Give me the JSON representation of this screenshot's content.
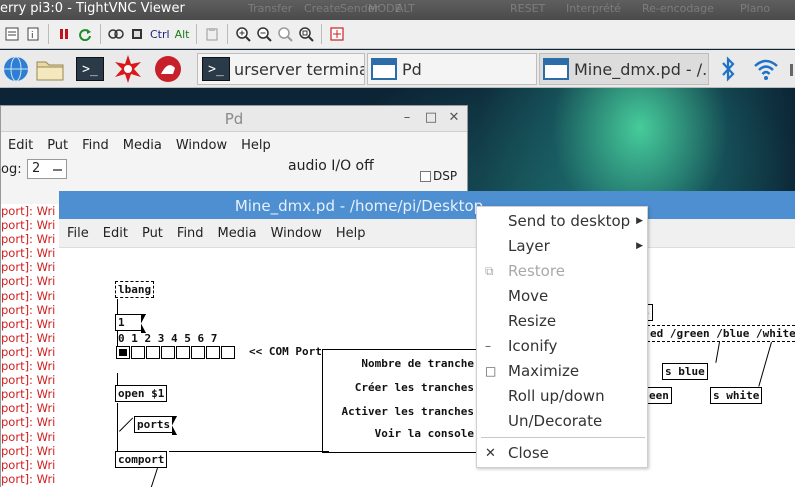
{
  "vnc": {
    "title": "erry pi3:0 - TightVNC Viewer",
    "ghost_labels": [
      "Transfer",
      "Create",
      "Sender",
      "MODE",
      "ALT",
      "RESET",
      "Interprété",
      "Re-encodage",
      "Plano"
    ],
    "toolbar": {
      "ctrl_label": "Ctrl",
      "alt_label": "Alt",
      "icons": [
        "options-icon",
        "info-icon",
        "pause-icon",
        "refresh-icon",
        "keyboard-icon",
        "ctrl-alt-del-icon",
        "clipboard-icon",
        "zoom-in-icon",
        "zoom-out-icon",
        "zoom-100-icon",
        "zoom-fit-icon",
        "fullscreen-icon"
      ]
    }
  },
  "taskbar": {
    "launchers": [
      "globe-icon",
      "folder-icon",
      "terminal-icon",
      "wolfram-icon",
      "mathematica-icon"
    ],
    "tasks": [
      {
        "label": "urserver terminal",
        "icon": "terminal-icon",
        "active": false
      },
      {
        "label": "Pd",
        "icon": "window-icon",
        "active": false
      },
      {
        "label": "Mine_dmx.pd  - /...",
        "icon": "window-icon",
        "active": true
      }
    ],
    "tray": [
      "bluetooth-icon",
      "wifi-icon"
    ]
  },
  "pd_window": {
    "title": "Pd",
    "menu": [
      "Edit",
      "Put",
      "Find",
      "Media",
      "Window",
      "Help"
    ],
    "log_label": "og:",
    "log_value": "2",
    "audio_status": "audio I/O off",
    "dsp_label": "DSP",
    "log_lines": [
      "port]: Wri",
      "port]: Wri",
      "port]: Wri",
      "port]: Wri",
      "port]: Wri",
      "port]: Wri",
      "port]: Wri",
      "port]: Wri",
      "port]: Wri",
      "port]: Wri",
      "port]: Wri",
      "port]: Wri",
      "port]: Wri",
      "port]: Wri",
      "port]: Wri",
      "port]: Wri",
      "port]: Wri",
      "port]: Wri",
      "port]: Wri",
      "port]: Wri"
    ]
  },
  "mine_window": {
    "title": "Mine_dmx.pd  - /home/pi/Desktop",
    "menu": [
      "File",
      "Edit",
      "Put",
      "Find",
      "Media",
      "Window",
      "Help"
    ],
    "canvas": {
      "loadbang": "lbang",
      "msg_1": "1",
      "radio_numbers": "0 1 2 3 4 5 6 7",
      "com_port_label": "<< COM Port",
      "open_obj": "open $1",
      "ports_msg": "ports",
      "comport_obj": "comport",
      "gop_labels": [
        "Nombre de tranche",
        "Créer les tranches",
        "Activer les tranches",
        "Voir la console"
      ],
      "partial_num": "5",
      "colors_msg": "ed /green /blue /white",
      "s_blue": "s blue",
      "green_partial": "een",
      "s_white": "s white"
    }
  },
  "context_menu": {
    "items": [
      {
        "label": "Send to desktop",
        "submenu": true,
        "disabled": false,
        "icon": ""
      },
      {
        "label": "Layer",
        "submenu": true,
        "disabled": false,
        "icon": ""
      },
      {
        "label": "Restore",
        "submenu": false,
        "disabled": true,
        "icon": "restore-icon"
      },
      {
        "label": "Move",
        "submenu": false,
        "disabled": false,
        "icon": ""
      },
      {
        "label": "Resize",
        "submenu": false,
        "disabled": false,
        "icon": ""
      },
      {
        "label": "Iconify",
        "submenu": false,
        "disabled": false,
        "icon": "iconify-icon"
      },
      {
        "label": "Maximize",
        "submenu": false,
        "disabled": false,
        "icon": "maximize-icon"
      },
      {
        "label": "Roll up/down",
        "submenu": false,
        "disabled": false,
        "icon": ""
      },
      {
        "label": "Un/Decorate",
        "submenu": false,
        "disabled": false,
        "icon": ""
      },
      {
        "label": "Close",
        "submenu": false,
        "disabled": false,
        "icon": "close-icon"
      }
    ]
  }
}
